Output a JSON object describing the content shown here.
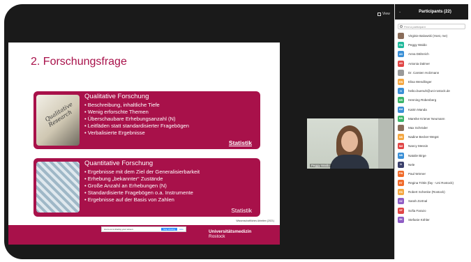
{
  "toolbar": {
    "view_label": "View"
  },
  "slide": {
    "title": "2. Forschungsfrage",
    "qualitative": {
      "heading": "Qualitative Forschung",
      "image_text": "Qualitative Research",
      "bullets": [
        "Beschreibung, inhaltliche Tiefe",
        "Wenig erforschte Themen",
        "Überschaubare Erhebungsanzahl (N)",
        "Leitfäden statt standardisierter Fragebögen",
        "Verbalisierte Ergebnisse"
      ],
      "stat_label": "Statistik"
    },
    "quantitative": {
      "heading": "Quantitative Forschung",
      "bullets": [
        "Ergebnisse mit dem Ziel der Generalisierbarkeit",
        "Erhebung „bekannter“ Zustände",
        "Große Anzahl an Erhebungen (N)",
        "Standardisierte Fragebögen o.a. Instrumente",
        "Ergebnisse auf der Basis von Zahlen"
      ],
      "stat_label": "Statistik"
    },
    "source": "Wissenschaftliches Arbeiten (2021)",
    "footer": {
      "line1": "Universitätsmedizin",
      "line2": "Rostock"
    }
  },
  "share_bar": {
    "message": "zoom.us is sharing your screen.",
    "stop_label": "Stop sharing",
    "hide_label": "Hide"
  },
  "video": {
    "name": "Peggy Waldo"
  },
  "participants": {
    "title": "Participants (22)",
    "search_placeholder": "Find a participant",
    "list": [
      {
        "initials": "",
        "name": "Virginie Balowski (Host, me)",
        "color": "#8a6d5a"
      },
      {
        "initials": "PW",
        "name": "Peggy Waldo",
        "color": "#1fb89a"
      },
      {
        "initials": "AD",
        "name": "Anna Dähnrich",
        "color": "#3a8fd6"
      },
      {
        "initials": "AD",
        "name": "Antonia Dalmer",
        "color": "#e04646"
      },
      {
        "initials": "",
        "name": "Dr. Carsten Holzmann",
        "color": "#9a9a9a"
      },
      {
        "initials": "EW",
        "name": "Elisa Wendlinger",
        "color": "#f4a742"
      },
      {
        "initials": "H",
        "name": "heiko.buenuh@uni-rostock.de",
        "color": "#3a8fd6"
      },
      {
        "initials": "HR",
        "name": "Henning Rübenberg",
        "color": "#3cb56a"
      },
      {
        "initials": "KM",
        "name": "Katrin Manda",
        "color": "#3a8fd6"
      },
      {
        "initials": "MN",
        "name": "Mareike Kriener Neumann",
        "color": "#3cb56a"
      },
      {
        "initials": "",
        "name": "Max Schröder",
        "color": "#8a6d5a"
      },
      {
        "initials": "NB",
        "name": "Nadine Becker-Wegst",
        "color": "#f4a742"
      },
      {
        "initials": "NM",
        "name": "Nancy Messin",
        "color": "#e04646"
      },
      {
        "initials": "NB",
        "name": "Natalie Birge",
        "color": "#3a8fd6"
      },
      {
        "initials": "N",
        "name": "Nele",
        "color": "#3a3f6b"
      },
      {
        "initials": "PW",
        "name": "Paul Wörner",
        "color": "#f06a2a"
      },
      {
        "initials": "RT",
        "name": "Regina Trittin (fay - Uni Rostock)",
        "color": "#f06a2a"
      },
      {
        "initials": "RS",
        "name": "Robert Schenke (Rostock)",
        "color": "#f4a742"
      },
      {
        "initials": "SZ",
        "name": "Sarah Zortnal",
        "color": "#8e5cc4"
      },
      {
        "initials": "SF",
        "name": "Sofia Farazo",
        "color": "#e04646"
      },
      {
        "initials": "SK",
        "name": "Stefanie Köhler",
        "color": "#8e5cc4"
      }
    ]
  }
}
